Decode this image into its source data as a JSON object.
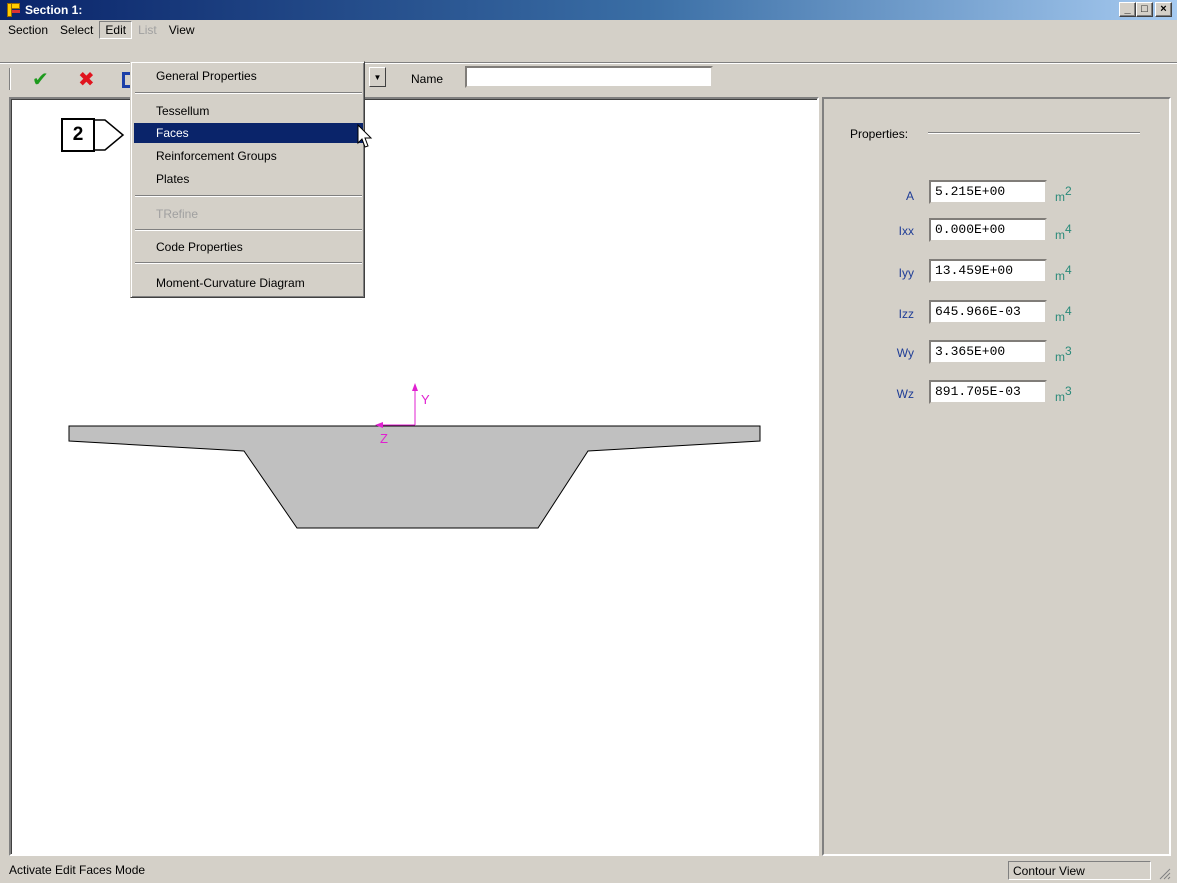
{
  "window": {
    "title": "Section 1:",
    "buttons": {
      "minimize": "_",
      "maximize": "□",
      "close": "×"
    }
  },
  "menubar": {
    "items": [
      {
        "label": "Section",
        "state": "normal"
      },
      {
        "label": "Select",
        "state": "normal"
      },
      {
        "label": "Edit",
        "state": "open"
      },
      {
        "label": "List",
        "state": "disabled"
      },
      {
        "label": "View",
        "state": "normal"
      }
    ]
  },
  "toolbar": {
    "ok_icon": "checkmark-icon",
    "cancel_icon": "cross-icon",
    "name_label": "Name",
    "name_value": ""
  },
  "edit_menu": {
    "items": [
      {
        "label": "General Properties"
      },
      {
        "label": "Tessellum"
      },
      {
        "label": "Faces",
        "highlighted": true
      },
      {
        "label": "Reinforcement Groups"
      },
      {
        "label": "Plates"
      },
      {
        "label": "TRefine",
        "disabled": true
      },
      {
        "label": "Code Properties"
      },
      {
        "label": "Moment-Curvature Diagram"
      }
    ]
  },
  "callout": {
    "number": "2"
  },
  "canvas": {
    "axis_y_label": "Y",
    "axis_z_label": "Z",
    "section_fill": "#c0c0c0",
    "axis_color": "#e020d0"
  },
  "properties": {
    "header": "Properties:",
    "rows": [
      {
        "label": "A",
        "value": "5.215E+00",
        "unit": "m",
        "exp": "2"
      },
      {
        "label": "Ixx",
        "value": "0.000E+00",
        "unit": "m",
        "exp": "4"
      },
      {
        "label": "Iyy",
        "value": "13.459E+00",
        "unit": "m",
        "exp": "4"
      },
      {
        "label": "Izz",
        "value": "645.966E-03",
        "unit": "m",
        "exp": "4"
      },
      {
        "label": "Wy",
        "value": "3.365E+00",
        "unit": "m",
        "exp": "3"
      },
      {
        "label": "Wz",
        "value": "891.705E-03",
        "unit": "m",
        "exp": "3"
      }
    ]
  },
  "statusbar": {
    "message": "Activate Edit Faces Mode",
    "view_mode": "Contour View"
  },
  "colors": {
    "titlebar_start": "#0a246a",
    "titlebar_end": "#a6caf0",
    "menu_highlight": "#0a246a",
    "label_blue": "#1e3c96",
    "unit_teal": "#2a8a7a"
  }
}
